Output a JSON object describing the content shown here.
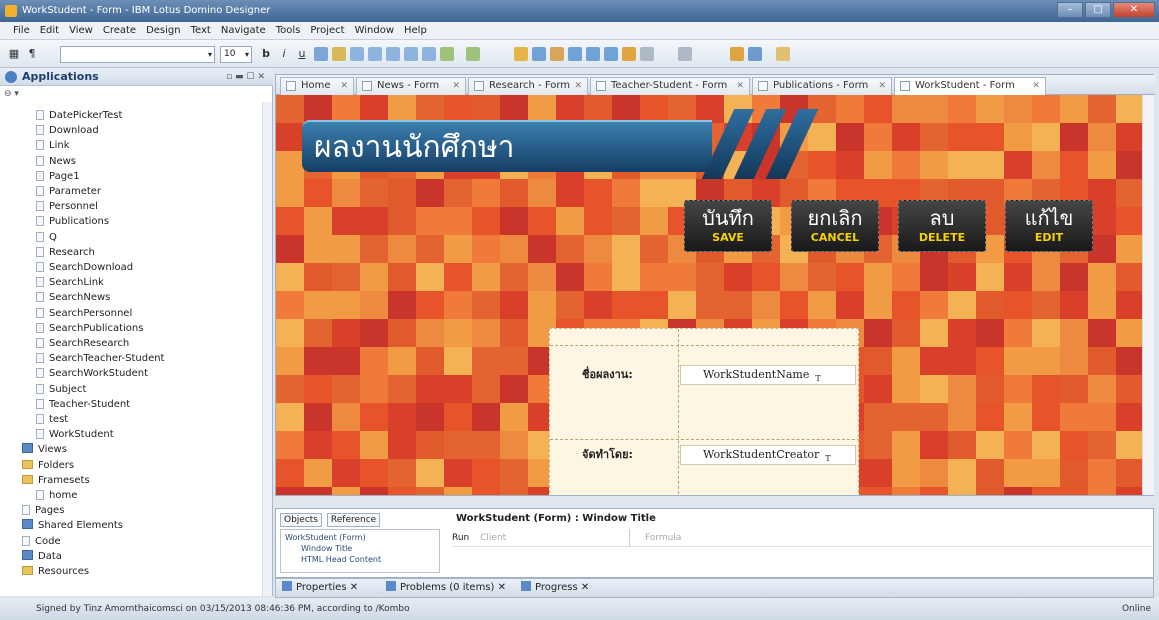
{
  "window": {
    "title": "WorkStudent - Form - IBM Lotus Domino Designer"
  },
  "menu": [
    "File",
    "Edit",
    "View",
    "Create",
    "Design",
    "Text",
    "Navigate",
    "Tools",
    "Project",
    "Window",
    "Help"
  ],
  "toolbar": {
    "font_size": "10"
  },
  "left_panel": {
    "title": "Applications",
    "tree": [
      {
        "label": "DatePickerTest",
        "kind": "doc"
      },
      {
        "label": "Download",
        "kind": "doc"
      },
      {
        "label": "Link",
        "kind": "doc"
      },
      {
        "label": "News",
        "kind": "doc"
      },
      {
        "label": "Page1",
        "kind": "doc"
      },
      {
        "label": "Parameter",
        "kind": "doc"
      },
      {
        "label": "Personnel",
        "kind": "doc"
      },
      {
        "label": "Publications",
        "kind": "doc"
      },
      {
        "label": "Q",
        "kind": "doc"
      },
      {
        "label": "Research",
        "kind": "doc"
      },
      {
        "label": "SearchDownload",
        "kind": "doc"
      },
      {
        "label": "SearchLink",
        "kind": "doc"
      },
      {
        "label": "SearchNews",
        "kind": "doc"
      },
      {
        "label": "SearchPersonnel",
        "kind": "doc"
      },
      {
        "label": "SearchPublications",
        "kind": "doc"
      },
      {
        "label": "SearchResearch",
        "kind": "doc"
      },
      {
        "label": "SearchTeacher-Student",
        "kind": "doc"
      },
      {
        "label": "SearchWorkStudent",
        "kind": "doc"
      },
      {
        "label": "Subject",
        "kind": "doc"
      },
      {
        "label": "Teacher-Student",
        "kind": "doc"
      },
      {
        "label": "test",
        "kind": "doc"
      },
      {
        "label": "WorkStudent",
        "kind": "doc"
      },
      {
        "label": "Views",
        "kind": "blue"
      },
      {
        "label": "Folders",
        "kind": "fold"
      },
      {
        "label": "Framesets",
        "kind": "fold"
      },
      {
        "label": "home",
        "kind": "doc"
      },
      {
        "label": "Pages",
        "kind": "doc"
      },
      {
        "label": "Shared Elements",
        "kind": "blue"
      },
      {
        "label": "Code",
        "kind": "doc"
      },
      {
        "label": "Data",
        "kind": "blue"
      },
      {
        "label": "Resources",
        "kind": "fold"
      }
    ]
  },
  "tabs": [
    "Home",
    "News - Form",
    "Research - Form",
    "Teacher-Student - Form",
    "Publications - Form",
    "WorkStudent - Form"
  ],
  "form": {
    "banner_title": "ผลงานนักศึกษา",
    "buttons": [
      {
        "th": "บันทึก",
        "en": "SAVE"
      },
      {
        "th": "ยกเลิก",
        "en": "CANCEL"
      },
      {
        "th": "ลบ",
        "en": "DELETE"
      },
      {
        "th": "แก้ไข",
        "en": "EDIT"
      }
    ],
    "fields": [
      {
        "label": "ชื่อผลงาน:",
        "name": "WorkStudentName",
        "type": "T"
      },
      {
        "label": "จัดทำโดย:",
        "name": "WorkStudentCreator",
        "type": "T"
      }
    ]
  },
  "bottom": {
    "tab_objects": "Objects",
    "tab_reference": "Reference",
    "tree": [
      "WorkStudent (Form)",
      "Window Title",
      "HTML Head Content"
    ],
    "title": "WorkStudent (Form) : Window Title",
    "run_label": "Run",
    "run_value": "Client",
    "formula_label": "Formula"
  },
  "view_tabs": [
    "Properties",
    "Problems (0 items)",
    "Progress"
  ],
  "status": {
    "text": "Signed by Tinz Amornthaicomsci on 03/15/2013 08:46:36 PM, according to /Kombo",
    "online": "Online"
  }
}
